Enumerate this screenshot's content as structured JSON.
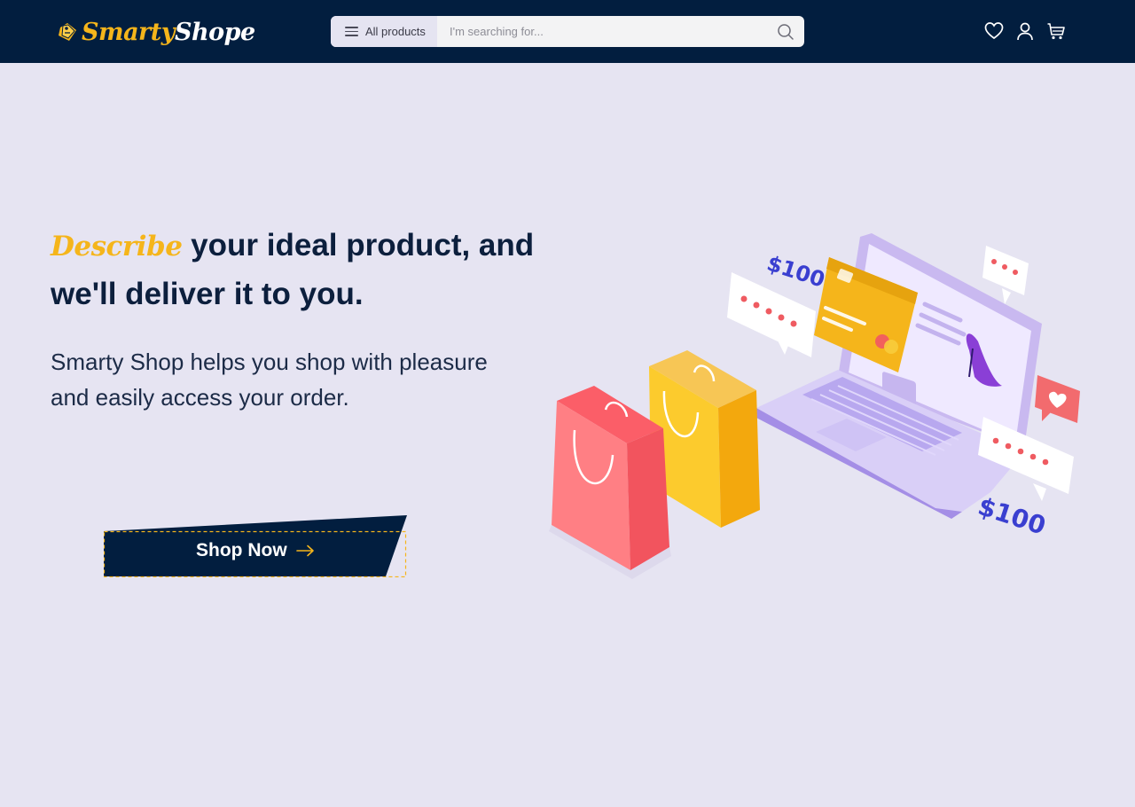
{
  "brand": {
    "name_part1": "Smarty",
    "name_part2": "Shope"
  },
  "search": {
    "category_label": "All products",
    "placeholder": "I'm searching for..."
  },
  "hero": {
    "headline_accent": "Describe",
    "headline_rest": " your ideal product, and we'll deliver it to you.",
    "subtext": "Smarty Shop helps you shop with pleasure and easily access your order.",
    "cta_label": "Shop Now"
  },
  "illustration": {
    "price_tag": "$100"
  },
  "colors": {
    "header_bg": "#021e3f",
    "accent": "#f5b51b",
    "page_bg": "#e6e4f2",
    "text_dark": "#0c1f3d"
  }
}
